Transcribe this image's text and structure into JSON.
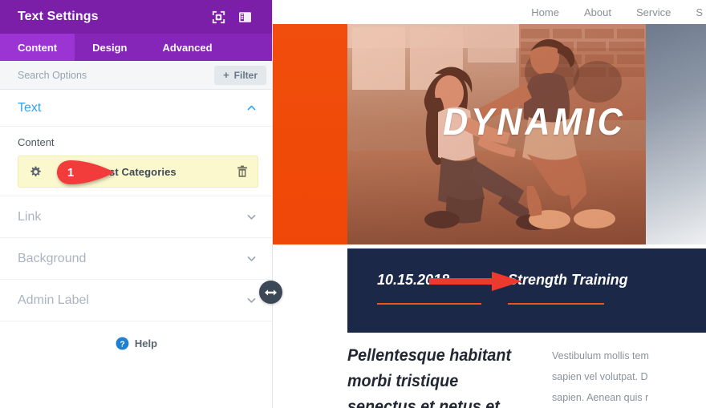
{
  "panel": {
    "title": "Text Settings",
    "header_icons": [
      {
        "name": "focus-target-icon"
      },
      {
        "name": "layout-panel-icon"
      }
    ],
    "tabs": [
      {
        "label": "Content",
        "active": true
      },
      {
        "label": "Design",
        "active": false
      },
      {
        "label": "Advanced",
        "active": false
      }
    ],
    "search": {
      "placeholder": "Search Options",
      "value": ""
    },
    "filter_button": {
      "plus": "+",
      "label": "Filter"
    },
    "sections": [
      {
        "label": "Text",
        "state": "open"
      },
      {
        "label": "Link",
        "state": "closed"
      },
      {
        "label": "Background",
        "state": "closed"
      },
      {
        "label": "Admin Label",
        "state": "closed"
      }
    ],
    "text_section": {
      "field_label": "Content",
      "item": {
        "label": "Post Categories",
        "gear_icon": "gear-icon",
        "trash_icon": "trash-icon"
      },
      "callout_number": "1"
    },
    "help": {
      "label": "Help",
      "icon": "question-mark-icon"
    },
    "resize_handle": {
      "icon": "horizontal-resize-arrows-icon"
    },
    "colors": {
      "header_purple": "#7b1fa9",
      "tabbar_purple": "#8626b8",
      "active_tab_purple": "#9b34d3",
      "highlight_yellow": "#fbf8cd",
      "link_blue": "#2ea3f2",
      "callout_red": "#f23b3b"
    }
  },
  "site": {
    "nav": [
      {
        "label": "Home"
      },
      {
        "label": "About"
      },
      {
        "label": "Service"
      },
      {
        "label": "S"
      }
    ],
    "hero": {
      "title": "DYNAMIC",
      "accent_color": "#f14d0c",
      "photo_alt": "two-women-training-in-gym"
    },
    "meta": {
      "date": "10.15.2018",
      "category": "Strength Training",
      "rule_color": "#f0551c",
      "bar_color": "#1b2847"
    },
    "article": {
      "heading": "Pellentesque habitant morbi tristique senectus et netus et",
      "paragraph_lines": [
        "Vestibulum mollis tem",
        "sapien vel volutpat. D",
        "sapien. Aenean quis r"
      ]
    },
    "annotation": {
      "arrow": "red-arrow-right"
    }
  }
}
